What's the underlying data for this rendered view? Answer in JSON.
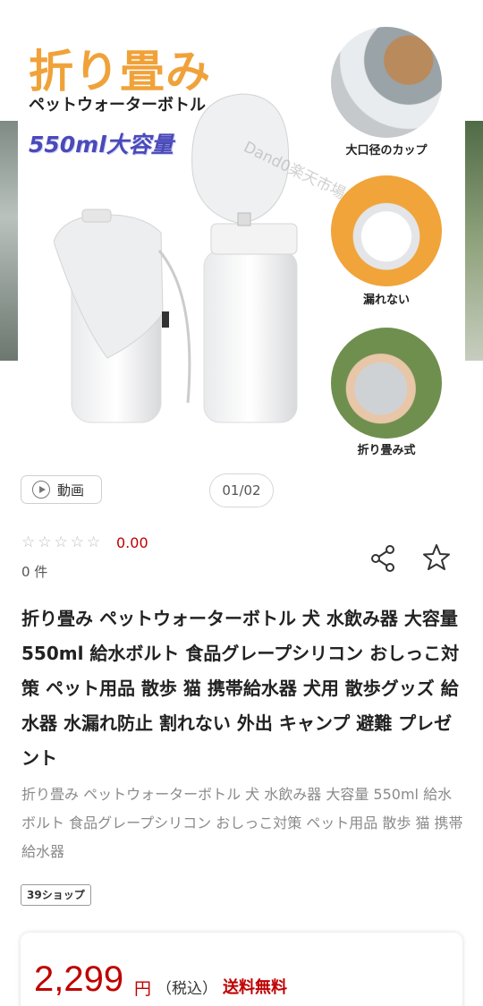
{
  "hero": {
    "title": "折り畳み",
    "subtitle": "ペットウォーターボトル",
    "capacity": "550ml大容量",
    "watermark": "Dand0楽天市場店",
    "features": [
      {
        "caption": "大口径のカップ"
      },
      {
        "caption": "漏れない"
      },
      {
        "caption": "折り畳み式"
      }
    ]
  },
  "media": {
    "video_label": "動画",
    "counter": "01/02"
  },
  "rating": {
    "stars": [
      "☆",
      "☆",
      "☆",
      "☆",
      "☆"
    ],
    "value": "0.00",
    "count": "0 件"
  },
  "product": {
    "title": "折り畳み ペットウォーターボトル 犬 水飲み器 大容量 550ml 給水ボルト 食品グレープシリコン おしっこ対策 ペット用品 散歩 猫 携帯給水器 犬用 散歩グッズ 給水器 水漏れ防止 割れない 外出 キャンプ 避難 プレゼント",
    "subtitle": "折り畳み ペットウォーターボトル 犬 水飲み器 大容量 550ml 給水ボルト 食品グレープシリコン おしっこ対策 ペット用品 散歩 猫 携帯給水器",
    "shop_badge": "39ショップ"
  },
  "price": {
    "amount": "2,299",
    "yen": "円",
    "tax": "（税込）",
    "shipping": "送料無料"
  },
  "colors": {
    "accent_red": "#bf0000",
    "hero_orange": "#f0a23a",
    "hero_purple": "#4a4ab8"
  }
}
